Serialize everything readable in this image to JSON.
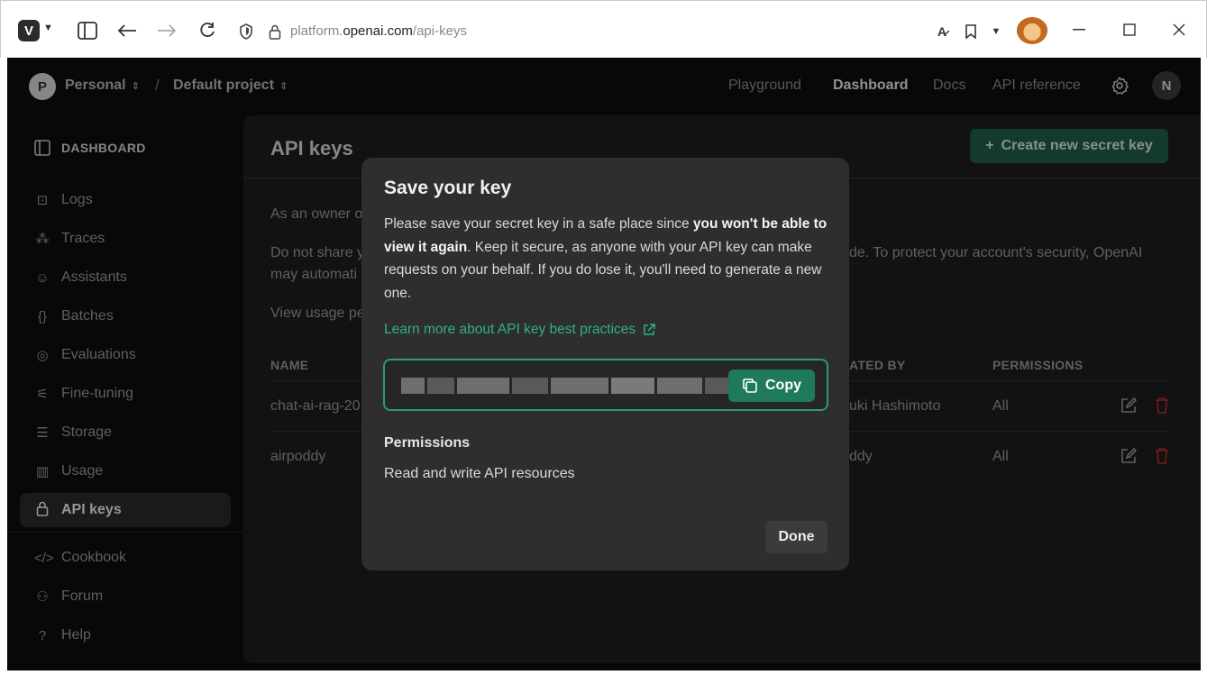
{
  "browser": {
    "url_host": "platform.",
    "url_domain": "openai.com",
    "url_path": "/api-keys",
    "window_controls": [
      "minimize-icon",
      "maximize-icon",
      "close-icon"
    ]
  },
  "topbar": {
    "org_initial": "P",
    "org_name": "Personal",
    "separator": "/",
    "project_name": "Default project",
    "nav": [
      "Playground",
      "Dashboard",
      "Docs",
      "API reference"
    ],
    "active_nav": "Dashboard",
    "user_initial": "N"
  },
  "sidebar": {
    "heading": "DASHBOARD",
    "items": [
      {
        "label": "Logs",
        "icon": "terminal-icon"
      },
      {
        "label": "Traces",
        "icon": "traces-icon"
      },
      {
        "label": "Assistants",
        "icon": "robot-icon"
      },
      {
        "label": "Batches",
        "icon": "braces-icon"
      },
      {
        "label": "Evaluations",
        "icon": "compass-icon"
      },
      {
        "label": "Fine-tuning",
        "icon": "sliders-icon"
      },
      {
        "label": "Storage",
        "icon": "database-icon"
      },
      {
        "label": "Usage",
        "icon": "bar-chart-icon"
      },
      {
        "label": "API keys",
        "icon": "lock-icon",
        "active": true
      }
    ],
    "bottom_items": [
      {
        "label": "Cookbook",
        "icon": "code-icon"
      },
      {
        "label": "Forum",
        "icon": "people-icon"
      },
      {
        "label": "Help",
        "icon": "help-icon"
      }
    ]
  },
  "main": {
    "title": "API keys",
    "create_button": "Create new secret key",
    "para1": "As an owner o",
    "para2_left": "Do not share y",
    "para2_right": "de. To protect your account's security, OpenAI",
    "para2_line2": "may automati",
    "para3": "View usage pe",
    "columns": {
      "name": "NAME",
      "created_by": "ATED BY",
      "permissions": "PERMISSIONS"
    },
    "rows": [
      {
        "name": "chat-ai-rag-20",
        "created_by": "uki Hashimoto",
        "permissions": "All"
      },
      {
        "name": "airpoddy",
        "created_by": "ddy",
        "permissions": "All"
      }
    ]
  },
  "modal": {
    "title": "Save your key",
    "desc_part1": "Please save your secret key in a safe place since ",
    "desc_bold": "you won't be able to view it again",
    "desc_part2": ". Keep it secure, as anyone with your API key can make requests on your behalf. If you do lose it, you'll need to generate a new one.",
    "learn_link": "Learn more about API key best practices",
    "copy_button": "Copy",
    "permissions_title": "Permissions",
    "permissions_value": "Read and write API resources",
    "done_button": "Done"
  },
  "colors": {
    "accent_green": "#1f7a5c",
    "link_green": "#2fb089",
    "danger_red": "#b3312b"
  }
}
